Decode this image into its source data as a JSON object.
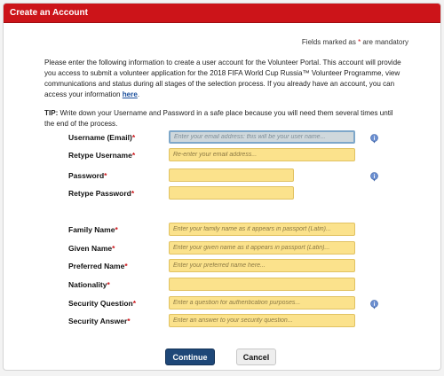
{
  "panel": {
    "title": "Create an Account"
  },
  "mandatory_note": {
    "prefix": "Fields marked as ",
    "star": "*",
    "suffix": " are mandatory"
  },
  "intro": {
    "text": "Please enter the following information to create a user account for the Volunteer Portal. This account will provide you access to submit a volunteer application for the 2018 FIFA World Cup Russia™ Volunteer Programme, view communications and status during all stages of the selection process. If you already have an account, you can access your information ",
    "link_label": "here",
    "suffix": "."
  },
  "tip": {
    "label": "TIP:",
    "text": " Write down your Username and Password in a safe place because you will need them several times until the end of the process."
  },
  "fields": {
    "username": {
      "label": "Username (Email)",
      "required": "*",
      "value": "",
      "placeholder": "Enter your email address: this will be your user name..."
    },
    "retype_username": {
      "label": "Retype Username",
      "required": "*",
      "value": "",
      "placeholder": "Re-enter your email address..."
    },
    "password": {
      "label": "Password",
      "required": "*",
      "value": "",
      "placeholder": ""
    },
    "retype_password": {
      "label": "Retype Password",
      "required": "*",
      "value": "",
      "placeholder": ""
    },
    "family_name": {
      "label": "Family Name",
      "required": "*",
      "value": "",
      "placeholder": "Enter your family name as it appears in passport (Latin)..."
    },
    "given_name": {
      "label": "Given Name",
      "required": "*",
      "value": "",
      "placeholder": "Enter your given name as it appears in passport (Latin)..."
    },
    "preferred_name": {
      "label": "Preferred Name",
      "required": "*",
      "value": "",
      "placeholder": "Enter your preferred name here..."
    },
    "nationality": {
      "label": "Nationality",
      "required": "*",
      "value": "",
      "placeholder": ""
    },
    "security_question": {
      "label": "Security Question",
      "required": "*",
      "value": "",
      "placeholder": "Enter a question for authentication purposes..."
    },
    "security_answer": {
      "label": "Security Answer",
      "required": "*",
      "value": "",
      "placeholder": "Enter an answer to your security question..."
    }
  },
  "buttons": {
    "continue_label": "Continue",
    "cancel_label": "Cancel"
  },
  "icons": {
    "info": "info-icon"
  },
  "colors": {
    "header_red": "#cc1419",
    "field_yellow": "#fbe28c",
    "primary_blue": "#1e4778",
    "required_star": "#cc1419"
  }
}
